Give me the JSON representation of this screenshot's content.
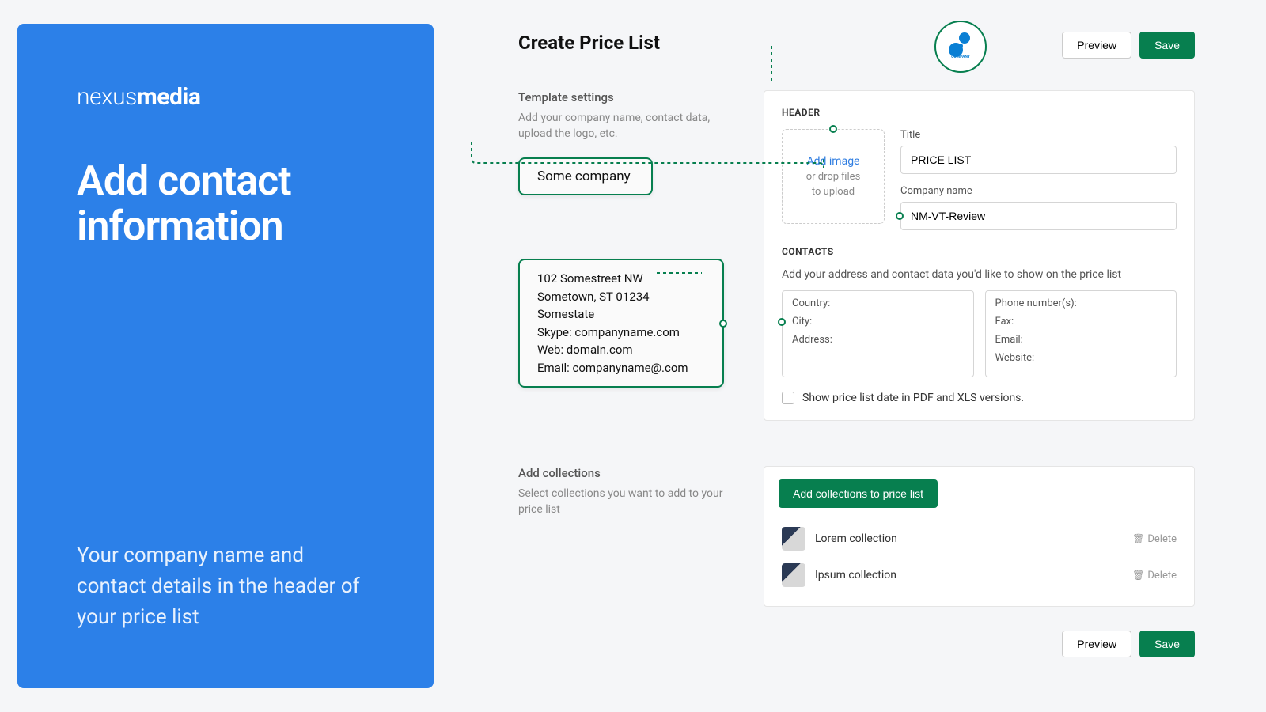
{
  "sidebar": {
    "brand_light": "nexus",
    "brand_bold": "media",
    "title_line1": "Add contact",
    "title_line2": "information",
    "subtitle": "Your company name and contact details in the header of your price list"
  },
  "page": {
    "title": "Create Price List",
    "preview_label": "Preview",
    "save_label": "Save"
  },
  "template": {
    "section_title": "Template settings",
    "section_desc": "Add your company name, contact data, upload the logo, etc.",
    "company_callout": "Some company",
    "contact_callout": {
      "street": "102 Somestreet NW",
      "city": "Sometown, ST 01234",
      "state": "Somestate",
      "skype": "Skype: companyname.com",
      "web": "Web: domain.com",
      "email": "Email: companyname@.com"
    }
  },
  "header_panel": {
    "label": "HEADER",
    "add_image": "Add image",
    "drop_1": "or drop files",
    "drop_2": "to upload",
    "title_label": "Title",
    "title_value": "PRICE LIST",
    "company_label": "Company name",
    "company_value": "NM-VT-Review",
    "logo_text": "COMPANY"
  },
  "contacts_panel": {
    "label": "CONTACTS",
    "desc": "Add your address and contact data you'd like to show on the price list",
    "left": {
      "country": "Country:",
      "city": "City:",
      "address": "Address:"
    },
    "right": {
      "phone": "Phone number(s):",
      "fax": "Fax:",
      "email": "Email:",
      "website": "Website:"
    },
    "checkbox_label": "Show price list date in PDF and XLS versions."
  },
  "collections": {
    "section_title": "Add collections",
    "section_desc": "Select collections you want to add to your price list",
    "add_button": "Add collections to price list",
    "delete_label": "Delete",
    "items": [
      {
        "name": "Lorem collection"
      },
      {
        "name": "Ipsum collection"
      }
    ]
  }
}
